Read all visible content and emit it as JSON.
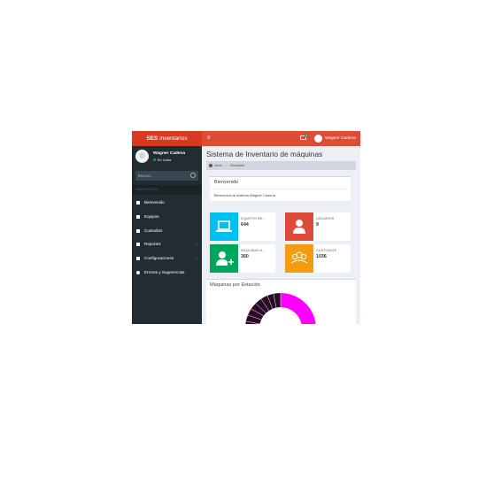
{
  "header": {
    "logo_bold": "SES",
    "logo_rest": " inventarios",
    "toggle_glyph": "≡",
    "mail_badge": "4",
    "user_name": "Wagner Cadena"
  },
  "sidebar": {
    "user_name": "Wagner Cadena",
    "status": "En Línea",
    "search_placeholder": "Buscar...",
    "nav_header": "NAVEGACIÓN",
    "items": [
      {
        "label": "Bienvenido",
        "icon": "home-icon"
      },
      {
        "label": "Equipos",
        "icon": "equipment-icon"
      },
      {
        "label": "Custodios",
        "icon": "user-icon"
      },
      {
        "label": "Reportes",
        "icon": "report-icon",
        "chevron": "‹"
      },
      {
        "label": "Configuraciones",
        "icon": "wrench-icon",
        "chevron": "‹"
      },
      {
        "label": "Errores y Sugerencias",
        "icon": "info-icon"
      }
    ]
  },
  "content": {
    "title": "Sistema de Inventario de máquinas",
    "breadcrumb": {
      "home": "Inicio",
      "current": "Escritorio"
    },
    "welcome": {
      "title": "Bienvenido",
      "body": "Bienvenido al sistema Wagner Cadena"
    },
    "info_boxes": [
      {
        "label": "EQUIPOS RE...",
        "value": "644",
        "color": "#00c0ef",
        "icon": "laptop-icon"
      },
      {
        "label": "USUARIOS",
        "value": "9",
        "color": "#dd4b39",
        "icon": "user-icon"
      },
      {
        "label": "MÁQUINAS A...",
        "value": "360",
        "color": "#00a65a",
        "icon": "add-user-icon"
      },
      {
        "label": "CUSTODIOS",
        "value": "1036",
        "color": "#f39c12",
        "icon": "group-icon"
      }
    ],
    "chart_box": {
      "title": "Máquinas por Estación"
    }
  },
  "colors": {
    "brand": "#dd4b39",
    "brand_dark": "#d73925",
    "sidebar": "#222d32"
  }
}
